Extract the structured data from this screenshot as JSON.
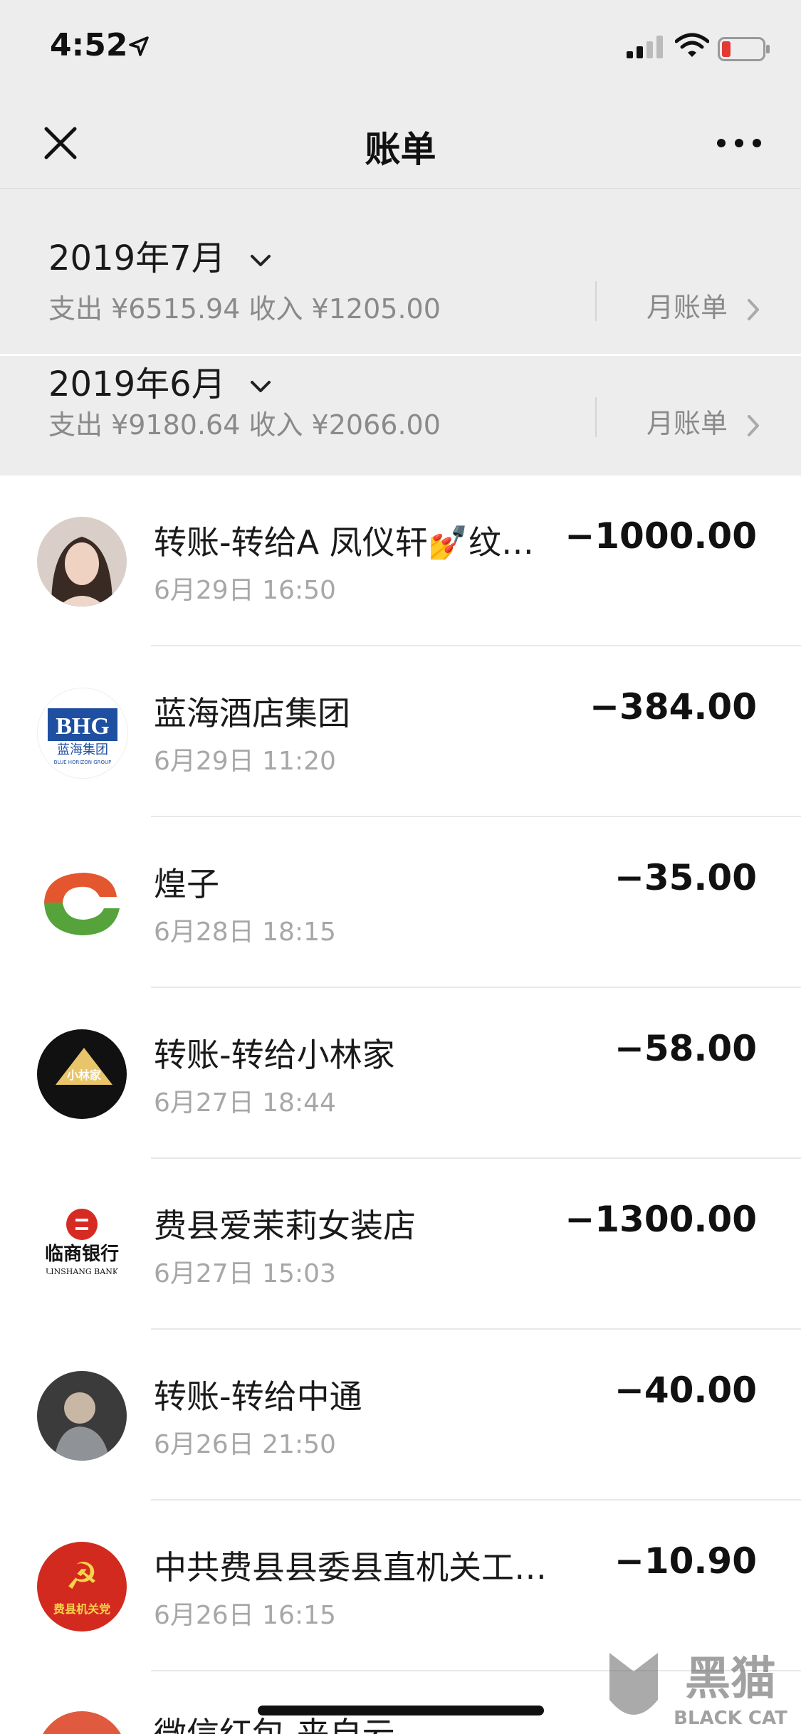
{
  "status": {
    "time": "4:52"
  },
  "nav": {
    "title": "账单"
  },
  "months": [
    {
      "title": "2019年7月",
      "summary": "支出 ¥6515.94 收入 ¥1205.00",
      "link": "月账单"
    },
    {
      "title": "2019年6月",
      "summary": "支出 ¥9180.64 收入 ¥2066.00",
      "link": "月账单"
    }
  ],
  "transactions": [
    {
      "title": "转账-转给A 凤仪轩💅纹…",
      "time": "6月29日 16:50",
      "amount": "−1000.00"
    },
    {
      "title": "蓝海酒店集团",
      "time": "6月29日 11:20",
      "amount": "−384.00",
      "logo_text": "BHG",
      "logo_sub": "蓝海集团",
      "logo_en": "BLUE HORIZON GROUP"
    },
    {
      "title": "煌子",
      "time": "6月28日 18:15",
      "amount": "−35.00"
    },
    {
      "title": "转账-转给小林家",
      "time": "6月27日 18:44",
      "amount": "−58.00",
      "logo_text": "小林家"
    },
    {
      "title": "费县爱茉莉女装店",
      "time": "6月27日 15:03",
      "amount": "−1300.00",
      "logo_text": "临商银行",
      "logo_en": "LINSHANG BANK"
    },
    {
      "title": "转账-转给中通",
      "time": "6月26日 21:50",
      "amount": "−40.00"
    },
    {
      "title": "中共费县县委县直机关工…",
      "time": "6月26日 16:15",
      "amount": "−10.90",
      "logo_text": "费县机关党"
    },
    {
      "title": "微信红包-来自云",
      "time": "",
      "amount": ""
    }
  ],
  "watermark": {
    "text": "黑猫",
    "sub": "BLACK CAT"
  },
  "colors": {
    "header_bg": "#ededed",
    "muted": "#8a8a8a",
    "time": "#a7a7a7"
  }
}
